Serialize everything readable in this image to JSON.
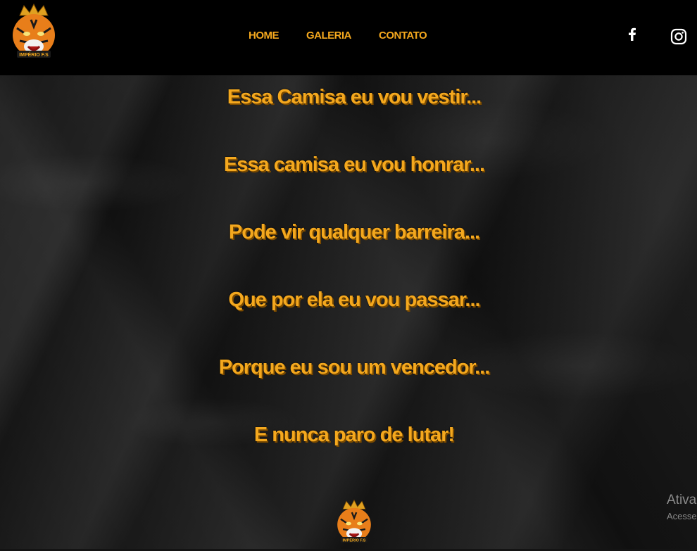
{
  "nav": {
    "items": [
      {
        "label": "HOME"
      },
      {
        "label": "GALERIA"
      },
      {
        "label": "CONTATO"
      }
    ]
  },
  "brand": {
    "logo_text": "IMPÉRIO F.S",
    "accent": "#f4a81e"
  },
  "social": {
    "icons": [
      "facebook-icon",
      "instagram-icon"
    ]
  },
  "lyrics": [
    "Essa Camisa eu vou vestir...",
    "Essa camisa eu vou honrar...",
    "Pode vir qualquer barreira...",
    "Que por ela eu vou passar...",
    "Porque eu sou um vencedor...",
    "E nunca paro de lutar!"
  ],
  "watermark": {
    "line1": "Ativa",
    "line2": "Acesse"
  }
}
